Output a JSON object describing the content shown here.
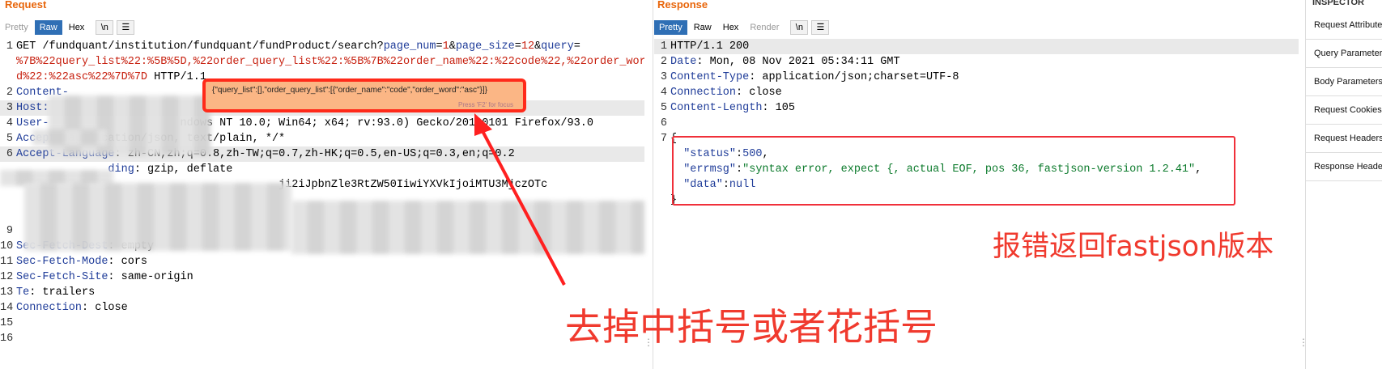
{
  "request": {
    "title": "Request",
    "tabs": [
      "Pretty",
      "Raw",
      "Hex"
    ],
    "newline_label": "\\n",
    "menu_icon": "hamburger-icon",
    "lines": [
      {
        "n": "1",
        "segments": [
          [
            "url",
            "GET /fundquant/institution/fundquant/fundProduct/search?"
          ],
          [
            "hk",
            "page_num"
          ],
          [
            "url",
            "="
          ],
          [
            "pv",
            "1"
          ],
          [
            "url",
            "&"
          ],
          [
            "hk",
            "page_size"
          ],
          [
            "url",
            "="
          ],
          [
            "pv",
            "12"
          ],
          [
            "url",
            "&"
          ],
          [
            "hk",
            "query"
          ],
          [
            "url",
            "="
          ]
        ]
      },
      {
        "n": "",
        "segments": [
          [
            "pv",
            "%7B%22query_list%22:%5B%5D,%22order_query_list%22:%5B%7B%22order_name%22:%22code%22,%22order_wor"
          ]
        ]
      },
      {
        "n": "",
        "segments": [
          [
            "pv",
            "d%22:%22asc%22%7D%7D"
          ],
          [
            "url",
            " HTTP/1.1"
          ]
        ]
      },
      {
        "n": "2",
        "segments": [
          [
            "hk",
            "Content-"
          ]
        ]
      },
      {
        "n": "3",
        "segments": [
          [
            "hk",
            "Host:"
          ]
        ],
        "hl": true
      },
      {
        "n": "4",
        "segments": [
          [
            "hk",
            "User-"
          ],
          [
            "url",
            "                    ndows NT 10.0; Win64; x64; rv:93.0) Gecko/20100101 Firefox/93.0"
          ]
        ]
      },
      {
        "n": "5",
        "segments": [
          [
            "hk",
            "Accept"
          ],
          [
            "url",
            ": application/json, text/plain, */*"
          ]
        ]
      },
      {
        "n": "6",
        "segments": [
          [
            "hk",
            "Accept-Language"
          ],
          [
            "url",
            ": zh-CN,zh;q=0.8,zh-TW;q=0.7,zh-HK;q=0.5,en-US;q=0.3,en;q=0.2"
          ]
        ],
        "hl": true
      },
      {
        "n": "",
        "segments": [
          [
            "hk",
            "              ding"
          ],
          [
            "url",
            ": gzip, deflate"
          ]
        ]
      },
      {
        "n": "",
        "segments": [
          [
            "url",
            "                                        ji2iJpbnZle3RtZW50IiwiYXVkIjoiMTU3MjczOTc"
          ]
        ]
      },
      {
        "n": "",
        "segments": [
          [
            "url",
            ""
          ]
        ]
      },
      {
        "n": "",
        "segments": [
          [
            "url",
            ""
          ]
        ]
      },
      {
        "n": "9",
        "segments": [
          [
            "url",
            ""
          ]
        ]
      },
      {
        "n": "10",
        "segments": [
          [
            "hk",
            "Sec-Fetch-Dest"
          ],
          [
            "url",
            ": empty"
          ]
        ]
      },
      {
        "n": "11",
        "segments": [
          [
            "hk",
            "Sec-Fetch-Mode"
          ],
          [
            "url",
            ": cors"
          ]
        ]
      },
      {
        "n": "12",
        "segments": [
          [
            "hk",
            "Sec-Fetch-Site"
          ],
          [
            "url",
            ": same-origin"
          ]
        ]
      },
      {
        "n": "13",
        "segments": [
          [
            "hk",
            "Te"
          ],
          [
            "url",
            ": trailers"
          ]
        ]
      },
      {
        "n": "14",
        "segments": [
          [
            "hk",
            "Connection"
          ],
          [
            "url",
            ": close"
          ]
        ]
      },
      {
        "n": "15",
        "segments": [
          [
            "url",
            ""
          ]
        ]
      },
      {
        "n": "16",
        "segments": [
          [
            "url",
            ""
          ]
        ]
      }
    ],
    "tooltip_text": "{\"query_list\":[],\"order_query_list\":[{\"order_name\":\"code\",\"order_word\":\"asc\"}]}",
    "tooltip_hint": "Press 'F2' for focus"
  },
  "response": {
    "title": "Response",
    "tabs": [
      "Pretty",
      "Raw",
      "Hex",
      "Render"
    ],
    "newline_label": "\\n",
    "menu_icon": "hamburger-icon",
    "lines": [
      {
        "n": "1",
        "segments": [
          [
            "url",
            "HTTP/1.1 200"
          ]
        ],
        "hl": true
      },
      {
        "n": "2",
        "segments": [
          [
            "hk",
            "Date"
          ],
          [
            "url",
            ": Mon, 08 Nov 2021 05:34:11 GMT"
          ]
        ]
      },
      {
        "n": "3",
        "segments": [
          [
            "hk",
            "Content-Type"
          ],
          [
            "url",
            ": application/json;charset=UTF-8"
          ]
        ]
      },
      {
        "n": "4",
        "segments": [
          [
            "hk",
            "Connection"
          ],
          [
            "url",
            ": close"
          ]
        ]
      },
      {
        "n": "5",
        "segments": [
          [
            "hk",
            "Content-Length"
          ],
          [
            "url",
            ": 105"
          ]
        ]
      },
      {
        "n": "6",
        "segments": [
          [
            "url",
            ""
          ]
        ]
      },
      {
        "n": "7",
        "segments": [
          [
            "url",
            "{"
          ]
        ]
      },
      {
        "n": "",
        "segments": [
          [
            "url",
            "  "
          ],
          [
            "hk",
            "\"status\""
          ],
          [
            "url",
            ":"
          ],
          [
            "hk",
            "500"
          ],
          [
            "url",
            ","
          ]
        ]
      },
      {
        "n": "",
        "segments": [
          [
            "url",
            "  "
          ],
          [
            "hk",
            "\"errmsg\""
          ],
          [
            "url",
            ":"
          ],
          [
            "str",
            "\"syntax error, expect {, actual EOF, pos 36, fastjson-version 1.2.41\""
          ],
          [
            "url",
            ","
          ]
        ]
      },
      {
        "n": "",
        "segments": [
          [
            "url",
            "  "
          ],
          [
            "hk",
            "\"data\""
          ],
          [
            "url",
            ":"
          ],
          [
            "hk",
            "null"
          ]
        ]
      },
      {
        "n": "",
        "segments": [
          [
            "url",
            "}"
          ]
        ]
      }
    ]
  },
  "annotations": {
    "version_note": "报错返回fastjson版本",
    "bracket_note": "去掉中括号或者花括号",
    "accent_color": "#f03a2e"
  },
  "inspector": {
    "title": "INSPECTOR",
    "items": [
      "Request Attributes",
      "Query Parameters",
      "Body Parameters",
      "Request Cookies",
      "Request Headers",
      "Response Headers"
    ]
  }
}
